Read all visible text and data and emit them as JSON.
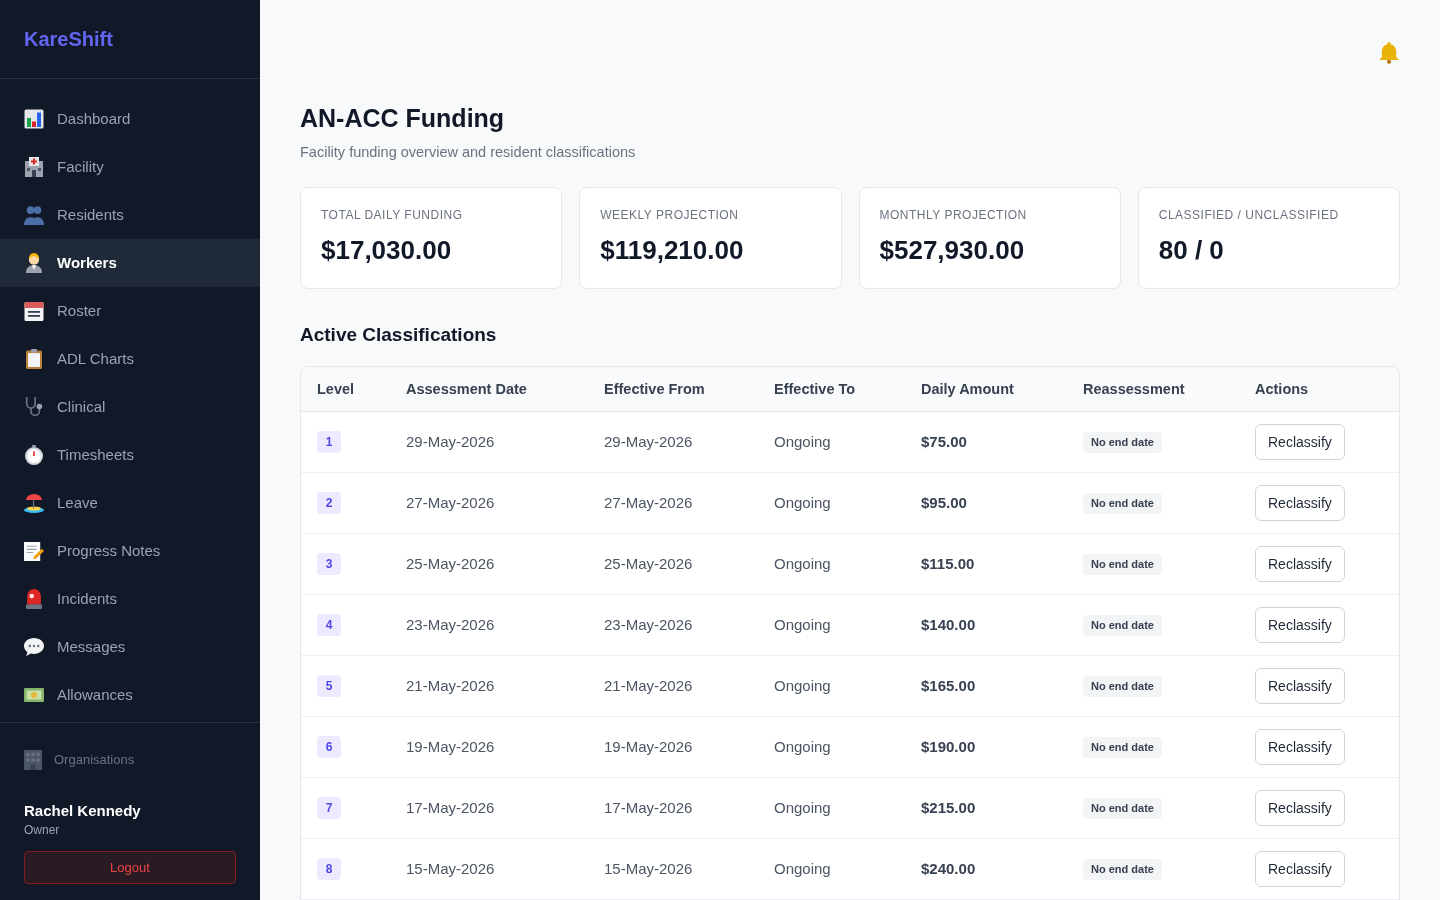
{
  "sidebar": {
    "brand": "KareShift",
    "items": [
      {
        "label": "Dashboard",
        "selected": false
      },
      {
        "label": "Facility",
        "selected": false
      },
      {
        "label": "Residents",
        "selected": false
      },
      {
        "label": "Workers",
        "selected": true
      },
      {
        "label": "Roster",
        "selected": false
      },
      {
        "label": "ADL Charts",
        "selected": false
      },
      {
        "label": "Clinical",
        "selected": false
      },
      {
        "label": "Timesheets",
        "selected": false
      },
      {
        "label": "Leave",
        "selected": false
      },
      {
        "label": "Progress Notes",
        "selected": false
      },
      {
        "label": "Incidents",
        "selected": false
      },
      {
        "label": "Messages",
        "selected": false
      },
      {
        "label": "Allowances",
        "selected": false
      }
    ],
    "organisations": "Organisations",
    "user": {
      "name": "Rachel Kennedy",
      "role": "Owner"
    },
    "logout": "Logout"
  },
  "page": {
    "title": "AN-ACC Funding",
    "subtitle": "Facility funding overview and resident classifications"
  },
  "stats": [
    {
      "label": "TOTAL DAILY FUNDING",
      "value": "$17,030.00"
    },
    {
      "label": "WEEKLY PROJECTION",
      "value": "$119,210.00"
    },
    {
      "label": "MONTHLY PROJECTION",
      "value": "$527,930.00"
    },
    {
      "label": "CLASSIFIED / UNCLASSIFIED",
      "value": "80 / 0"
    }
  ],
  "classifications": {
    "title": "Active Classifications",
    "columns": [
      "Level",
      "Assessment Date",
      "Effective From",
      "Effective To",
      "Daily Amount",
      "Reassessment",
      "Actions"
    ],
    "rows": [
      {
        "level": "1",
        "assessment_date": "29-May-2026",
        "effective_from": "29-May-2026",
        "effective_to": "Ongoing",
        "daily_amount": "$75.00",
        "reassessment": "No end date",
        "action": "Reclassify"
      },
      {
        "level": "2",
        "assessment_date": "27-May-2026",
        "effective_from": "27-May-2026",
        "effective_to": "Ongoing",
        "daily_amount": "$95.00",
        "reassessment": "No end date",
        "action": "Reclassify"
      },
      {
        "level": "3",
        "assessment_date": "25-May-2026",
        "effective_from": "25-May-2026",
        "effective_to": "Ongoing",
        "daily_amount": "$115.00",
        "reassessment": "No end date",
        "action": "Reclassify"
      },
      {
        "level": "4",
        "assessment_date": "23-May-2026",
        "effective_from": "23-May-2026",
        "effective_to": "Ongoing",
        "daily_amount": "$140.00",
        "reassessment": "No end date",
        "action": "Reclassify"
      },
      {
        "level": "5",
        "assessment_date": "21-May-2026",
        "effective_from": "21-May-2026",
        "effective_to": "Ongoing",
        "daily_amount": "$165.00",
        "reassessment": "No end date",
        "action": "Reclassify"
      },
      {
        "level": "6",
        "assessment_date": "19-May-2026",
        "effective_from": "19-May-2026",
        "effective_to": "Ongoing",
        "daily_amount": "$190.00",
        "reassessment": "No end date",
        "action": "Reclassify"
      },
      {
        "level": "7",
        "assessment_date": "17-May-2026",
        "effective_from": "17-May-2026",
        "effective_to": "Ongoing",
        "daily_amount": "$215.00",
        "reassessment": "No end date",
        "action": "Reclassify"
      },
      {
        "level": "8",
        "assessment_date": "15-May-2026",
        "effective_from": "15-May-2026",
        "effective_to": "Ongoing",
        "daily_amount": "$240.00",
        "reassessment": "No end date",
        "action": "Reclassify"
      }
    ]
  }
}
